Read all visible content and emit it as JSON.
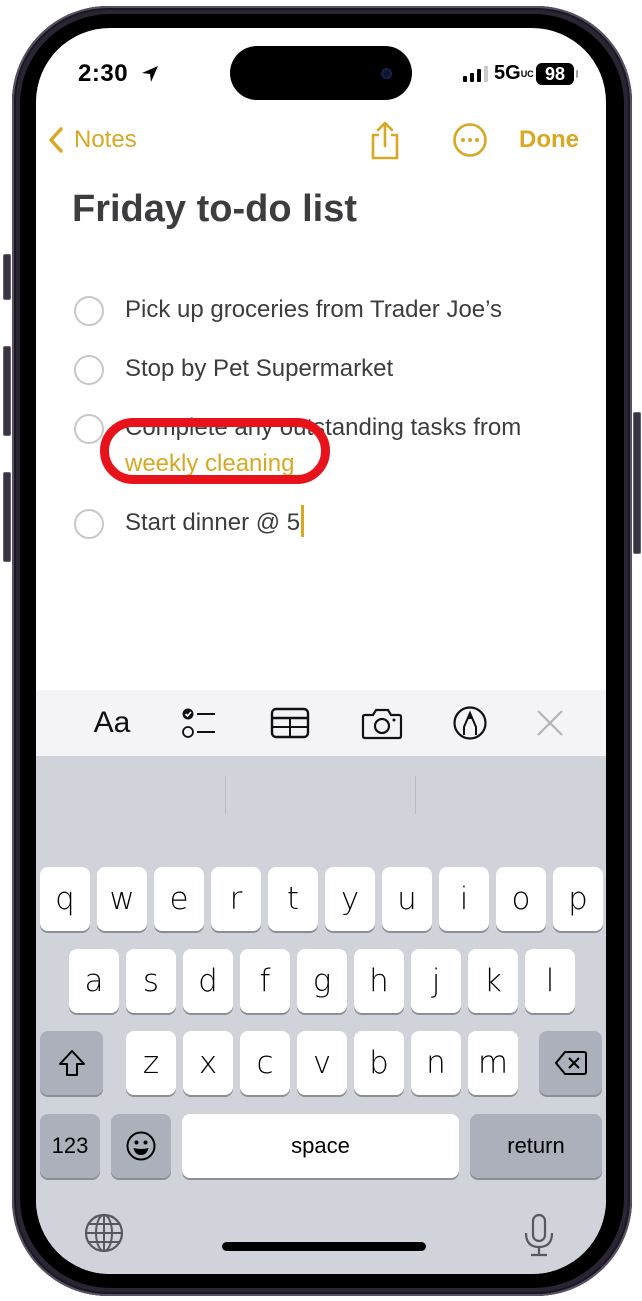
{
  "status_bar": {
    "time": "2:30",
    "location_icon": "location-arrow-icon",
    "signal_bars": 3,
    "signal_total": 4,
    "network": "5G UC",
    "network_label": "5G",
    "network_suffix": "UC",
    "battery": "98"
  },
  "nav": {
    "back_label": "Notes",
    "back_icon": "chevron-left-icon",
    "share_icon": "share-icon",
    "more_icon": "ellipsis-circle-icon",
    "done_label": "Done"
  },
  "note": {
    "title": "Friday to-do list",
    "items": [
      {
        "text": "Pick up groceries from Trader Joe’s",
        "checked": false
      },
      {
        "text": "Stop by Pet Supermarket",
        "checked": false
      },
      {
        "text": "Complete any outstanding tasks from",
        "link": "weekly cleaning",
        "checked": false
      },
      {
        "text": "Start dinner @ 5",
        "checked": false
      }
    ]
  },
  "annotation": {
    "target": "weekly cleaning",
    "color": "#e8131a"
  },
  "toolbar": {
    "format_label": "Aa",
    "items": [
      "format-icon",
      "checklist-icon",
      "table-icon",
      "camera-icon",
      "markup-icon",
      "close-icon"
    ]
  },
  "keyboard": {
    "row1": [
      "q",
      "w",
      "e",
      "r",
      "t",
      "y",
      "u",
      "i",
      "o",
      "p"
    ],
    "row2": [
      "a",
      "s",
      "d",
      "f",
      "g",
      "h",
      "j",
      "k",
      "l"
    ],
    "row3": [
      "z",
      "x",
      "c",
      "v",
      "b",
      "n",
      "m"
    ],
    "numbers_label": "123",
    "space_label": "space",
    "return_label": "return"
  },
  "colors": {
    "accent": "#d8a823",
    "text": "#3d3d3f",
    "keyboard_bg": "#d0d3da"
  }
}
